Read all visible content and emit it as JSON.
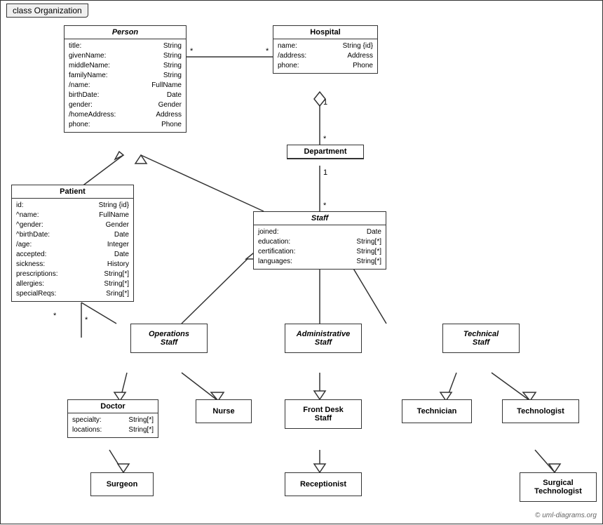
{
  "title": "class Organization",
  "copyright": "© uml-diagrams.org",
  "classes": {
    "person": {
      "name": "Person",
      "attrs": [
        {
          "name": "title:",
          "type": "String"
        },
        {
          "name": "givenName:",
          "type": "String"
        },
        {
          "name": "middleName:",
          "type": "String"
        },
        {
          "name": "familyName:",
          "type": "String"
        },
        {
          "name": "/name:",
          "type": "FullName"
        },
        {
          "name": "birthDate:",
          "type": "Date"
        },
        {
          "name": "gender:",
          "type": "Gender"
        },
        {
          "name": "/homeAddress:",
          "type": "Address"
        },
        {
          "name": "phone:",
          "type": "Phone"
        }
      ]
    },
    "hospital": {
      "name": "Hospital",
      "attrs": [
        {
          "name": "name:",
          "type": "String {id}"
        },
        {
          "name": "/address:",
          "type": "Address"
        },
        {
          "name": "phone:",
          "type": "Phone"
        }
      ]
    },
    "patient": {
      "name": "Patient",
      "attrs": [
        {
          "name": "id:",
          "type": "String {id}"
        },
        {
          "name": "^name:",
          "type": "FullName"
        },
        {
          "name": "^gender:",
          "type": "Gender"
        },
        {
          "name": "^birthDate:",
          "type": "Date"
        },
        {
          "name": "/age:",
          "type": "Integer"
        },
        {
          "name": "accepted:",
          "type": "Date"
        },
        {
          "name": "sickness:",
          "type": "History"
        },
        {
          "name": "prescriptions:",
          "type": "String[*]"
        },
        {
          "name": "allergies:",
          "type": "String[*]"
        },
        {
          "name": "specialReqs:",
          "type": "Sring[*]"
        }
      ]
    },
    "department": {
      "name": "Department"
    },
    "staff": {
      "name": "Staff",
      "attrs": [
        {
          "name": "joined:",
          "type": "Date"
        },
        {
          "name": "education:",
          "type": "String[*]"
        },
        {
          "name": "certification:",
          "type": "String[*]"
        },
        {
          "name": "languages:",
          "type": "String[*]"
        }
      ]
    },
    "operations_staff": {
      "name": "Operations\nStaff"
    },
    "administrative_staff": {
      "name": "Administrative\nStaff"
    },
    "technical_staff": {
      "name": "Technical\nStaff"
    },
    "doctor": {
      "name": "Doctor",
      "attrs": [
        {
          "name": "specialty:",
          "type": "String[*]"
        },
        {
          "name": "locations:",
          "type": "String[*]"
        }
      ]
    },
    "nurse": {
      "name": "Nurse"
    },
    "front_desk_staff": {
      "name": "Front Desk\nStaff"
    },
    "technician": {
      "name": "Technician"
    },
    "technologist": {
      "name": "Technologist"
    },
    "surgeon": {
      "name": "Surgeon"
    },
    "receptionist": {
      "name": "Receptionist"
    },
    "surgical_technologist": {
      "name": "Surgical\nTechnologist"
    }
  }
}
